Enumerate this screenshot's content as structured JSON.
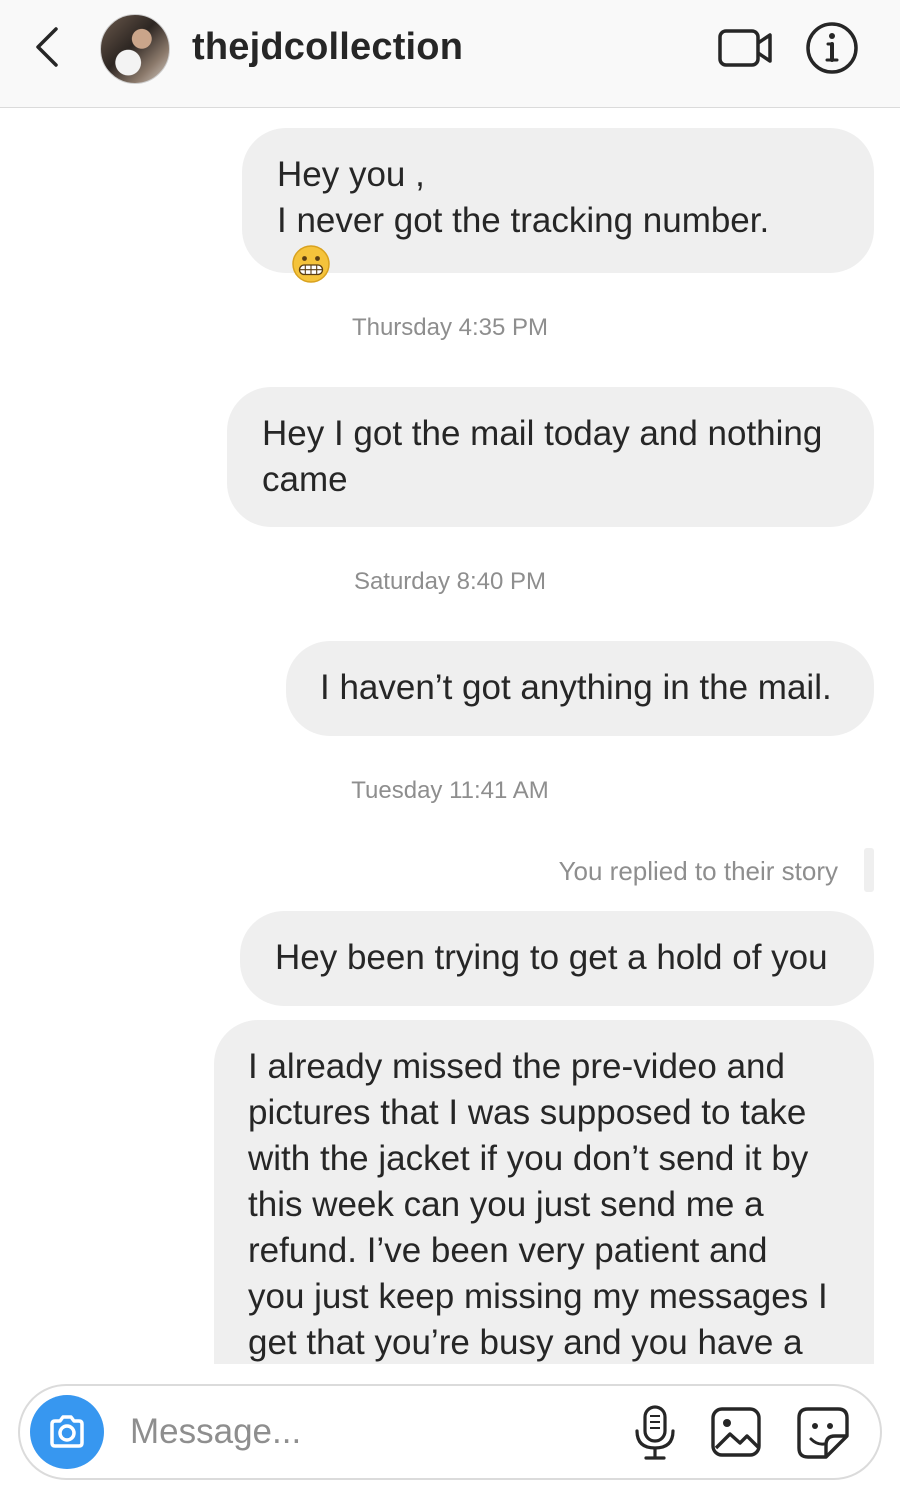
{
  "header": {
    "username": "thejdcollection",
    "back_icon": "chevron-left-icon",
    "video_icon": "video-camera-icon",
    "info_icon": "info-icon"
  },
  "thread": {
    "messages": [
      {
        "lines": [
          "Hey you ,",
          "I never got the tracking number."
        ],
        "emoji": "grimacing-face"
      },
      {
        "lines": [
          "Hey I got the mail today and nothing",
          "came"
        ]
      },
      {
        "lines": [
          "I haven’t got anything in the mail."
        ]
      },
      {
        "lines": [
          "Hey been trying to get a hold of you"
        ]
      },
      {
        "lines": [
          "I already missed the pre-video and",
          "pictures that I was supposed to take",
          "with the jacket if you don’t send it by",
          "this week can you just send me a",
          "refund. I’ve been very patient and",
          "you just keep missing my messages I",
          "get that you’re busy and you have a"
        ]
      }
    ],
    "timestamps": [
      "Thursday 4:35 PM",
      "Saturday 8:40 PM",
      "Tuesday 11:41 AM"
    ],
    "story_reply_note": "You replied to their story"
  },
  "composer": {
    "placeholder": "Message...",
    "camera_icon": "camera-icon",
    "mic_icon": "microphone-icon",
    "photo_icon": "photo-icon",
    "sticker_icon": "sticker-icon"
  },
  "colors": {
    "bubble_bg": "#efefef",
    "camera_button": "#3797f0",
    "timestamp_text": "#8e8e8e",
    "header_bg": "#f9f9f9"
  }
}
